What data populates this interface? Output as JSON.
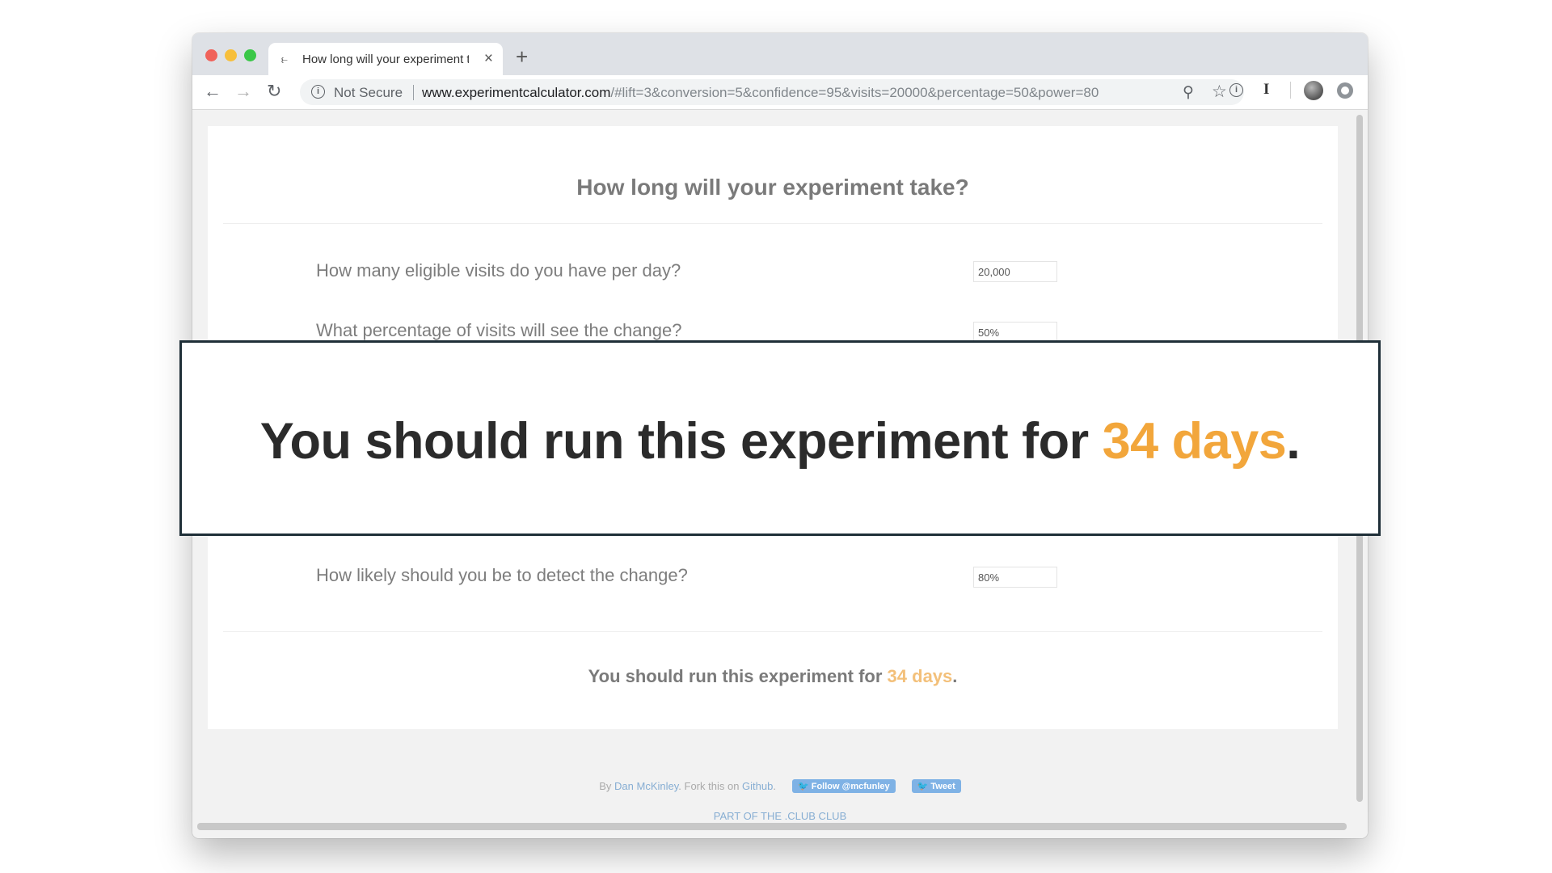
{
  "tab": {
    "title": "How long will your experiment take?",
    "close": "×",
    "new_tab": "+"
  },
  "toolbar": {
    "back": "←",
    "forward": "→",
    "reload": "↻",
    "not_secure": "Not Secure",
    "url_host": "www.experimentcalculator.com",
    "url_path": "/#lift=3&conversion=5&confidence=95&visits=20000&percentage=50&power=80",
    "info_glyph": "i",
    "zoom_glyph": "⚲",
    "star_glyph": "☆",
    "ext_glyph": "I"
  },
  "page": {
    "title": "How long will your experiment take?",
    "questions": [
      {
        "label": "How many eligible visits do you have per day?",
        "value": "20,000"
      },
      {
        "label": "What percentage of visits will see the change?",
        "value": "50%"
      },
      {
        "label": "How likely should you be to detect the change?",
        "value": "80%"
      }
    ],
    "result": {
      "prefix": "You should run this experiment for ",
      "duration": "34 days",
      "suffix": "."
    },
    "footer": {
      "by": "By ",
      "author": "Dan McKinley",
      "fork": ". Fork this on ",
      "github": "Github",
      "period": ".",
      "follow_button": "🐦 Follow @mcfunley",
      "tweet_button": "🐦 Tweet",
      "club": "PART OF THE .CLUB CLUB"
    }
  },
  "callout": {
    "prefix": "You should run this experiment for ",
    "duration": "34 days",
    "suffix": "."
  },
  "colors": {
    "accent": "#f2a63b",
    "link": "#87aed3",
    "callout_border": "#1f2f38"
  }
}
